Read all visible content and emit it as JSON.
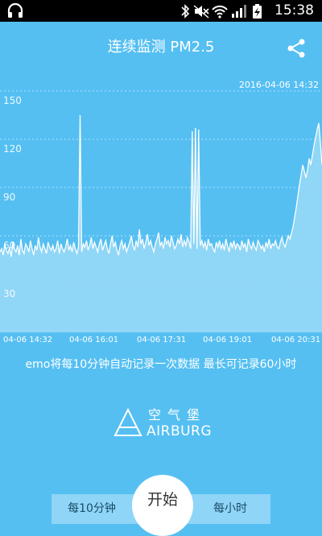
{
  "status_bar": {
    "time": "15:38",
    "icons": [
      "headphone-icon",
      "bluetooth-icon",
      "mute-icon",
      "wifi-icon",
      "signal-icon",
      "battery-charging-icon"
    ]
  },
  "header": {
    "title": "连续监测 PM2.5",
    "share_icon": "share-icon"
  },
  "chart_data": {
    "type": "area",
    "timestamp": "2016-04-06 14:32",
    "ylim": [
      0,
      160
    ],
    "yticks": [
      30,
      60,
      90,
      120,
      150
    ],
    "xtick_labels": [
      "04-06 14:32",
      "04-06 16:01",
      "04-06 17:31",
      "04-06 19:01",
      "04-06 20:31"
    ],
    "grid": true,
    "series": [
      {
        "values": [
          50,
          52,
          48,
          55,
          51,
          49,
          53,
          47,
          56,
          52,
          50,
          54,
          48,
          58,
          51,
          49,
          55,
          53,
          50,
          57,
          52,
          48,
          54,
          51,
          59,
          53,
          50,
          55,
          52,
          49,
          56,
          53,
          51,
          54,
          50,
          52,
          57,
          49,
          55,
          52,
          50,
          53,
          58,
          51,
          54,
          50,
          56,
          52,
          49,
          53,
          135,
          50,
          55,
          53,
          57,
          51,
          54,
          59,
          52,
          56,
          53,
          50,
          55,
          58,
          51,
          54,
          57,
          52,
          49,
          55,
          60,
          53,
          56,
          51,
          48,
          54,
          57,
          52,
          55,
          50,
          53,
          56,
          60,
          54,
          51,
          57,
          53,
          64,
          55,
          58,
          52,
          56,
          61,
          54,
          57,
          53,
          50,
          55,
          58,
          62,
          54,
          56,
          52,
          59,
          55,
          57,
          53,
          60,
          56,
          52,
          54,
          58,
          55,
          61,
          53,
          57,
          54,
          59,
          56,
          52,
          125,
          55,
          127,
          52,
          126,
          54,
          57,
          53,
          56,
          51,
          58,
          54,
          55,
          52,
          50,
          56,
          53,
          57,
          52,
          55,
          51,
          58,
          54,
          50,
          56,
          53,
          57,
          52,
          55,
          54,
          51,
          57,
          53,
          55,
          50,
          58,
          54,
          52,
          56,
          53,
          51,
          57,
          55,
          52,
          54,
          50,
          56,
          53,
          58,
          52,
          55,
          54,
          57,
          53,
          52,
          56,
          59,
          55,
          53,
          57,
          60,
          58,
          62,
          66,
          72,
          78,
          85,
          92,
          98,
          104,
          100,
          96,
          101,
          108,
          104,
          110,
          116,
          121,
          126,
          130,
          118,
          104
        ]
      }
    ]
  },
  "message": "emo将每10分钟自动记录一次数据 最长可记录60小时",
  "logo": {
    "name_cn": "空气堡",
    "name_en": "AIRBURG",
    "icon": "airburg-logo-icon"
  },
  "controls": {
    "left_tab": "每10分钟",
    "start_button": "开始",
    "right_tab": "每小时"
  },
  "colors": {
    "background": "#55bff2",
    "chart_fill": "#9bd9f7",
    "tab_bar": "#8fd5f7"
  }
}
